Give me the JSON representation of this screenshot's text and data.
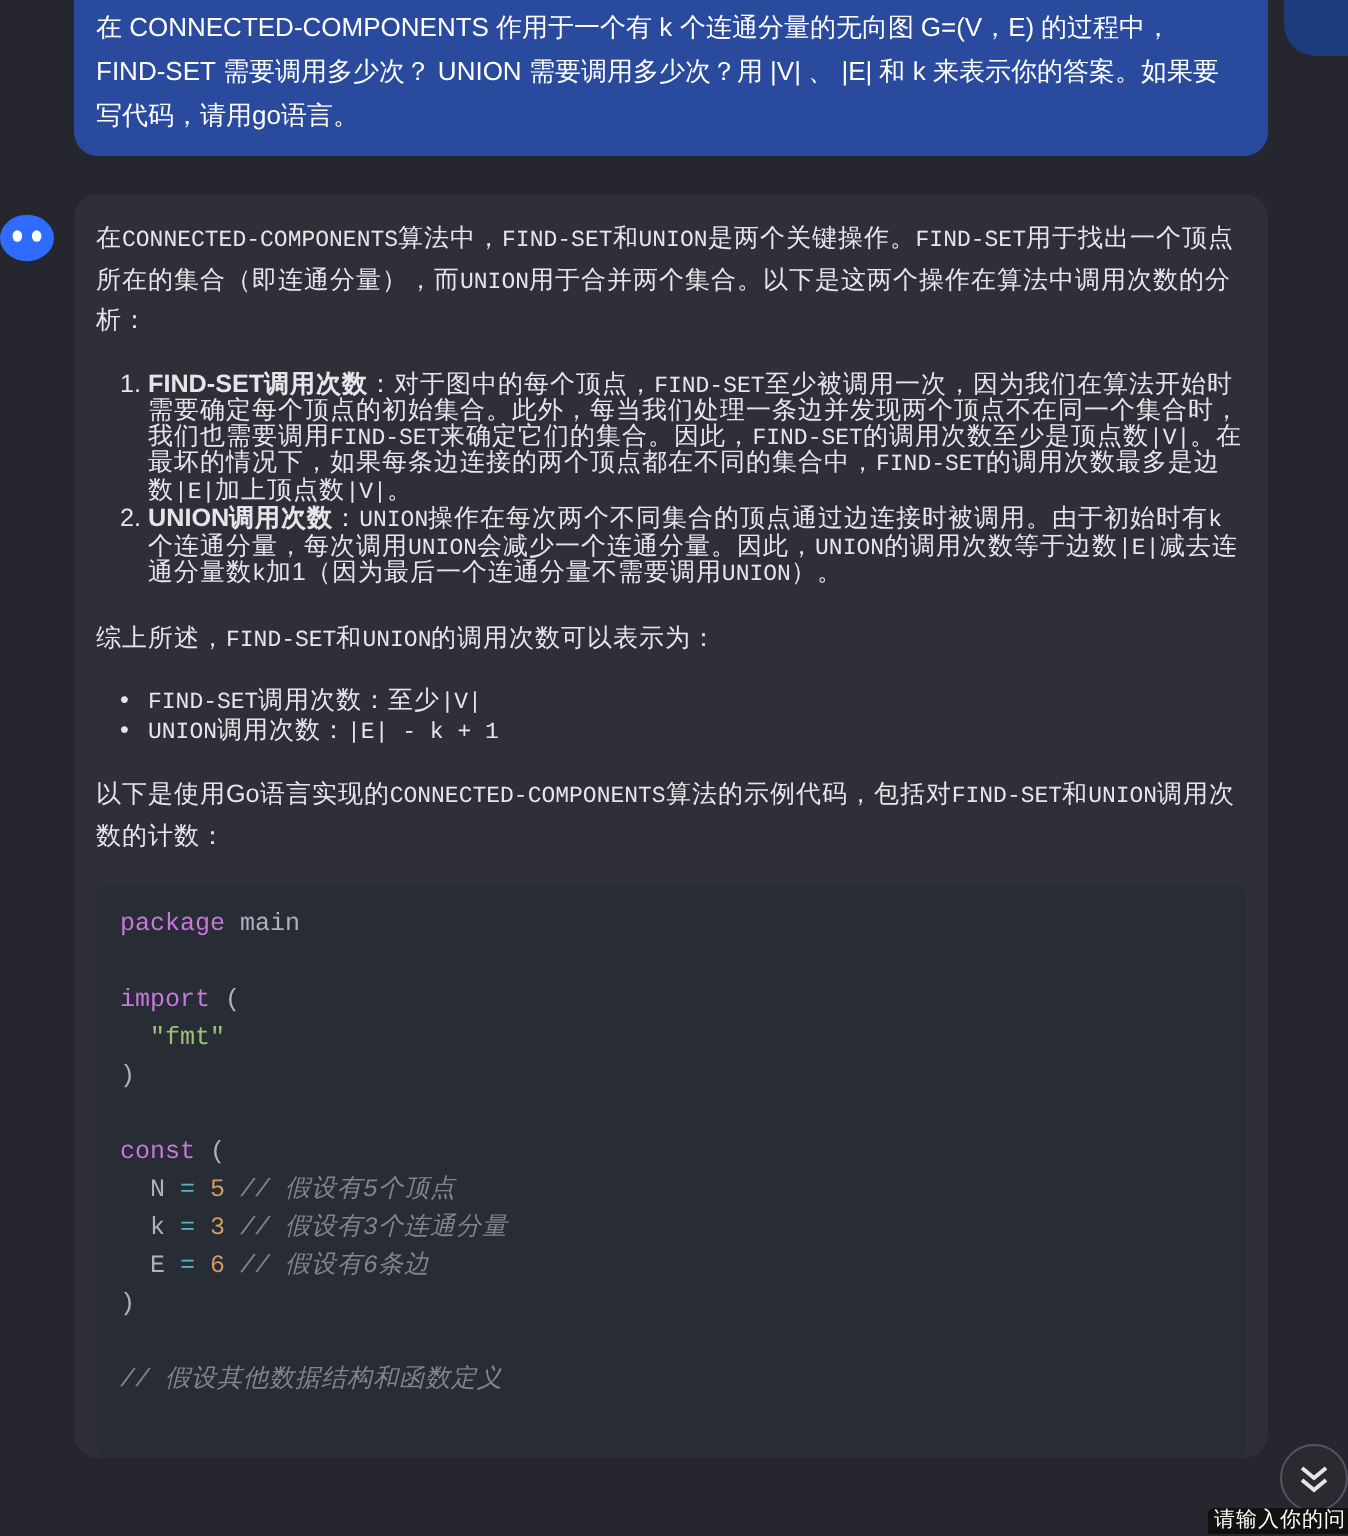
{
  "user_message": {
    "text": "在 CONNECTED-COMPONENTS 作用于一个有 k 个连通分量的无向图 G=(V，E) 的过程中，FIND-SET 需要调用多少次？ UNION 需要调用多少次？用 |V| 、 |E| 和 k 来表示你的答案。如果要写代码，请用go语言。"
  },
  "answer": {
    "blocks": [
      {
        "kind": "para",
        "segments": [
          {
            "kind": "text",
            "text": "在"
          },
          {
            "kind": "code",
            "text": "CONNECTED-COMPONENTS"
          },
          {
            "kind": "text",
            "text": "算法中，"
          },
          {
            "kind": "code",
            "text": "FIND-SET"
          },
          {
            "kind": "text",
            "text": "和"
          },
          {
            "kind": "code",
            "text": "UNION"
          },
          {
            "kind": "text",
            "text": "是两个关键操作。"
          },
          {
            "kind": "code",
            "text": "FIND-SET"
          },
          {
            "kind": "text",
            "text": "用于找出一个顶点所在的集合（即连通分量），而"
          },
          {
            "kind": "code",
            "text": "UNION"
          },
          {
            "kind": "text",
            "text": "用于合并两个集合。以下是这两个操作在算法中调用次数的分析："
          }
        ]
      },
      {
        "kind": "list",
        "items": [
          {
            "marker": "1.",
            "segments": [
              {
                "kind": "bold",
                "text": "FIND-SET调用次数"
              },
              {
                "kind": "text",
                "text": "：对于图中的每个顶点，"
              },
              {
                "kind": "code",
                "text": "FIND-SET"
              },
              {
                "kind": "text",
                "text": "至少被调用一次，因为我们在算法开始时需要确定每个顶点的初始集合。此外，每当我们处理一条边并发现两个顶点不在同一个集合时，我们也需要调用"
              },
              {
                "kind": "code",
                "text": "FIND-SET"
              },
              {
                "kind": "text",
                "text": "来确定它们的集合。因此，"
              },
              {
                "kind": "code",
                "text": "FIND-SET"
              },
              {
                "kind": "text",
                "text": "的调用次数至少是顶点数"
              },
              {
                "kind": "code",
                "text": "|V|"
              },
              {
                "kind": "text",
                "text": "。在最坏的情况下，如果每条边连接的两个顶点都在不同的集合中，"
              },
              {
                "kind": "code",
                "text": "FIND-SET"
              },
              {
                "kind": "text",
                "text": "的调用次数最多是边数"
              },
              {
                "kind": "code",
                "text": "|E|"
              },
              {
                "kind": "text",
                "text": "加上顶点数"
              },
              {
                "kind": "code",
                "text": "|V|"
              },
              {
                "kind": "text",
                "text": "。"
              }
            ]
          },
          {
            "marker": "2.",
            "segments": [
              {
                "kind": "bold",
                "text": "UNION调用次数"
              },
              {
                "kind": "text",
                "text": "："
              },
              {
                "kind": "code",
                "text": "UNION"
              },
              {
                "kind": "text",
                "text": "操作在每次两个不同集合的顶点通过边连接时被调用。由于初始时有"
              },
              {
                "kind": "code",
                "text": "k"
              },
              {
                "kind": "text",
                "text": "个连通分量，每次调用"
              },
              {
                "kind": "code",
                "text": "UNION"
              },
              {
                "kind": "text",
                "text": "会减少一个连通分量。因此，"
              },
              {
                "kind": "code",
                "text": "UNION"
              },
              {
                "kind": "text",
                "text": "的调用次数等于边数"
              },
              {
                "kind": "code",
                "text": "|E|"
              },
              {
                "kind": "text",
                "text": "减去连通分量数"
              },
              {
                "kind": "code",
                "text": "k"
              },
              {
                "kind": "text",
                "text": "加1（因为最后一个连通分量不需要调用"
              },
              {
                "kind": "code",
                "text": "UNION"
              },
              {
                "kind": "text",
                "text": "）。"
              }
            ]
          }
        ]
      },
      {
        "kind": "para",
        "segments": [
          {
            "kind": "text",
            "text": "综上所述，"
          },
          {
            "kind": "code",
            "text": "FIND-SET"
          },
          {
            "kind": "text",
            "text": "和"
          },
          {
            "kind": "code",
            "text": "UNION"
          },
          {
            "kind": "text",
            "text": "的调用次数可以表示为："
          }
        ]
      },
      {
        "kind": "list",
        "items": [
          {
            "marker": "•",
            "segments": [
              {
                "kind": "code",
                "text": "FIND-SET"
              },
              {
                "kind": "text",
                "text": "调用次数：至少"
              },
              {
                "kind": "code",
                "text": "|V|"
              }
            ]
          },
          {
            "marker": "•",
            "segments": [
              {
                "kind": "code",
                "text": "UNION"
              },
              {
                "kind": "text",
                "text": "调用次数："
              },
              {
                "kind": "code",
                "text": "|E| - k + 1"
              }
            ]
          }
        ]
      },
      {
        "kind": "para",
        "segments": [
          {
            "kind": "text",
            "text": "以下是使用Go语言实现的"
          },
          {
            "kind": "code",
            "text": "CONNECTED-COMPONENTS"
          },
          {
            "kind": "text",
            "text": "算法的示例代码，包括对"
          },
          {
            "kind": "code",
            "text": "FIND-SET"
          },
          {
            "kind": "text",
            "text": "和"
          },
          {
            "kind": "code",
            "text": "UNION"
          },
          {
            "kind": "text",
            "text": "调用次数的计数："
          }
        ]
      }
    ],
    "code_block": {
      "groups": [
        [
          [
            {
              "kind": "keyword",
              "text": "package"
            },
            {
              "kind": "plain",
              "text": " main"
            }
          ]
        ],
        [
          [
            {
              "kind": "keyword",
              "text": "import"
            },
            {
              "kind": "plain",
              "text": " ("
            }
          ],
          [
            {
              "kind": "string",
              "text": "  \"fmt\""
            }
          ],
          [
            {
              "kind": "plain",
              "text": ")"
            }
          ]
        ],
        [
          [
            {
              "kind": "keyword",
              "text": "const"
            },
            {
              "kind": "plain",
              "text": " ("
            }
          ],
          [
            {
              "kind": "plain",
              "text": "  N "
            },
            {
              "kind": "operator",
              "text": "="
            },
            {
              "kind": "number",
              "text": " 5"
            },
            {
              "kind": "comment",
              "text": " // 假设有5个顶点"
            }
          ],
          [
            {
              "kind": "plain",
              "text": "  k "
            },
            {
              "kind": "operator",
              "text": "="
            },
            {
              "kind": "number",
              "text": " 3"
            },
            {
              "kind": "comment",
              "text": " // 假设有3个连通分量"
            }
          ],
          [
            {
              "kind": "plain",
              "text": "  E "
            },
            {
              "kind": "operator",
              "text": "="
            },
            {
              "kind": "number",
              "text": " 6"
            },
            {
              "kind": "comment",
              "text": " // 假设有6条边"
            }
          ],
          [
            {
              "kind": "plain",
              "text": ")"
            }
          ]
        ],
        [
          [
            {
              "kind": "comment",
              "text": "// 假设其他数据结构和函数定义"
            }
          ]
        ]
      ]
    }
  },
  "input_tooltip": {
    "text": "请输入你的问"
  }
}
